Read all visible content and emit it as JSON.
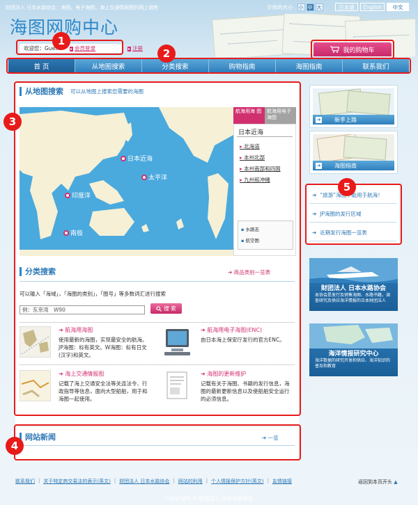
{
  "header": {
    "tagline": "财团法人 日本水路协会：海图、电子海图、海上交通情报图的网上销售",
    "site_title": "海图网购中心",
    "font_size_label": "字体的大小",
    "font_sizes": [
      "小",
      "中",
      "大"
    ],
    "languages": {
      "ja": "日本語",
      "en": "English",
      "zh": "中文"
    },
    "welcome": "欢迎您：Guest",
    "login_label": "会员登录",
    "register_label": "注册",
    "cart_label": "我的购物车"
  },
  "nav": {
    "items": [
      "首 页",
      "从地图搜索",
      "分类搜索",
      "购物指南",
      "海图指南",
      "联系我们"
    ]
  },
  "map_section": {
    "title": "从地图搜索",
    "subtitle": "可以从地图上搜索您需要的海图",
    "labels": {
      "japan": "日本近海",
      "pacific": "太平洋",
      "indian": "印度洋",
      "antarctic": "南极"
    },
    "tabs": [
      "航海用海 图",
      "航海用电子海图"
    ],
    "region_title": "日本近海",
    "regions": [
      "北海道",
      "本州北部",
      "本州南部和四国",
      "九州和冲绳"
    ],
    "sub_items": [
      "水路志",
      "航空图"
    ]
  },
  "category_section": {
    "title": "分类搜索",
    "list_link": "商品类别一览表",
    "hint": "可以输入「海域」，「海图的类别」，「图号」等多数词汇进行搜索",
    "search_placeholder": "例：东京湾　W90",
    "search_button": "搜 索",
    "items": [
      {
        "title": "航海用海图",
        "desc": "使用最新的海图，实现最安全的航海。JP海图：标有英文。W海图：标有日文(汉字)和英文。"
      },
      {
        "title": "航海用电子海图(ENC)",
        "desc": "由日本海上保安厅发行的官方ENC。"
      },
      {
        "title": "海上交通情报图",
        "desc": "记载了海上交通安全法等关连法令、行政指导等信息，面向大型船舶，用于和海图一起使用。"
      },
      {
        "title": "海图的更新维护",
        "desc": "记载有关于海图、书籍的发行信息，海图的最新更新信息以及使船舶安全运行的必须信息。"
      }
    ]
  },
  "news_section": {
    "title": "网站新闻",
    "more_link": "一览"
  },
  "sidebar": {
    "banners": [
      {
        "caption": "新手上路"
      },
      {
        "caption": "海图指南"
      }
    ],
    "links": [
      "“旅游”海图不能用于航海！",
      "JP海图的发行区域",
      "近期发行海图一览表"
    ],
    "ads": [
      {
        "title": "财团法人 日本水路协会",
        "desc": "本协会是发行及销售海图、水路书籍，调查研究及供应海洋情报的日本财团法人"
      },
      {
        "title": "海洋情报研究中心",
        "desc": "海洋数据的研究开发和供应、海洋知识的普及和教育"
      }
    ]
  },
  "callouts": [
    "1",
    "2",
    "3",
    "4",
    "5"
  ],
  "footer": {
    "links": [
      "联系我们",
      "关于特定商交易法的表示(英文)",
      "财团法人 日本水路协会",
      "网站的利用",
      "个人情报保护方针(英文)",
      "友情链接"
    ],
    "back_to_top": "返回到本页开头",
    "copyright": "Copyright © 财团法人 日本水路协会"
  },
  "colors": {
    "accent": "#2d87c8",
    "pink": "#d1306f",
    "callout": "#e81a1a"
  }
}
